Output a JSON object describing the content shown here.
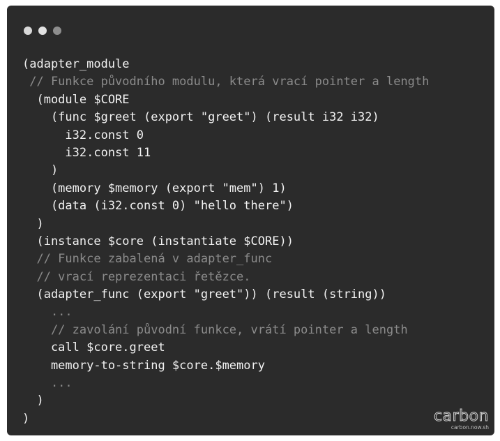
{
  "colors": {
    "window_background": "#2b2b2b",
    "code_text": "#f2f2f2",
    "comment_text": "#8b8b8b",
    "page_background": "#ffffff"
  },
  "window_controls": [
    "close-dot",
    "minimize-dot",
    "maximize-dot"
  ],
  "code": {
    "language": "wat",
    "lines": [
      {
        "text": "(adapter_module",
        "comment": false
      },
      {
        "text": " // Funkce původního modulu, která vrací pointer a length",
        "comment": true
      },
      {
        "text": "  (module $CORE",
        "comment": false
      },
      {
        "text": "    (func $greet (export \"greet\") (result i32 i32)",
        "comment": false
      },
      {
        "text": "      i32.const 0",
        "comment": false
      },
      {
        "text": "      i32.const 11",
        "comment": false
      },
      {
        "text": "    )",
        "comment": false
      },
      {
        "text": "    (memory $memory (export \"mem\") 1)",
        "comment": false
      },
      {
        "text": "    (data (i32.const 0) \"hello there\")",
        "comment": false
      },
      {
        "text": "  )",
        "comment": false
      },
      {
        "text": "  (instance $core (instantiate $CORE))",
        "comment": false
      },
      {
        "text": "  // Funkce zabalená v adapter_func",
        "comment": true
      },
      {
        "text": "  // vrací reprezentaci řetězce.",
        "comment": true
      },
      {
        "text": "  (adapter_func (export \"greet\")) (result (string))",
        "comment": false
      },
      {
        "text": "    ...",
        "comment": true
      },
      {
        "text": "    // zavolání původní funkce, vrátí pointer a length",
        "comment": true
      },
      {
        "text": "    call $core.greet",
        "comment": false
      },
      {
        "text": "    memory-to-string $core.$memory",
        "comment": false
      },
      {
        "text": "    ...",
        "comment": true
      },
      {
        "text": "  )",
        "comment": false
      },
      {
        "text": ")",
        "comment": false
      }
    ]
  },
  "branding": {
    "logo_text": "carbon",
    "url": "carbon.now.sh"
  }
}
